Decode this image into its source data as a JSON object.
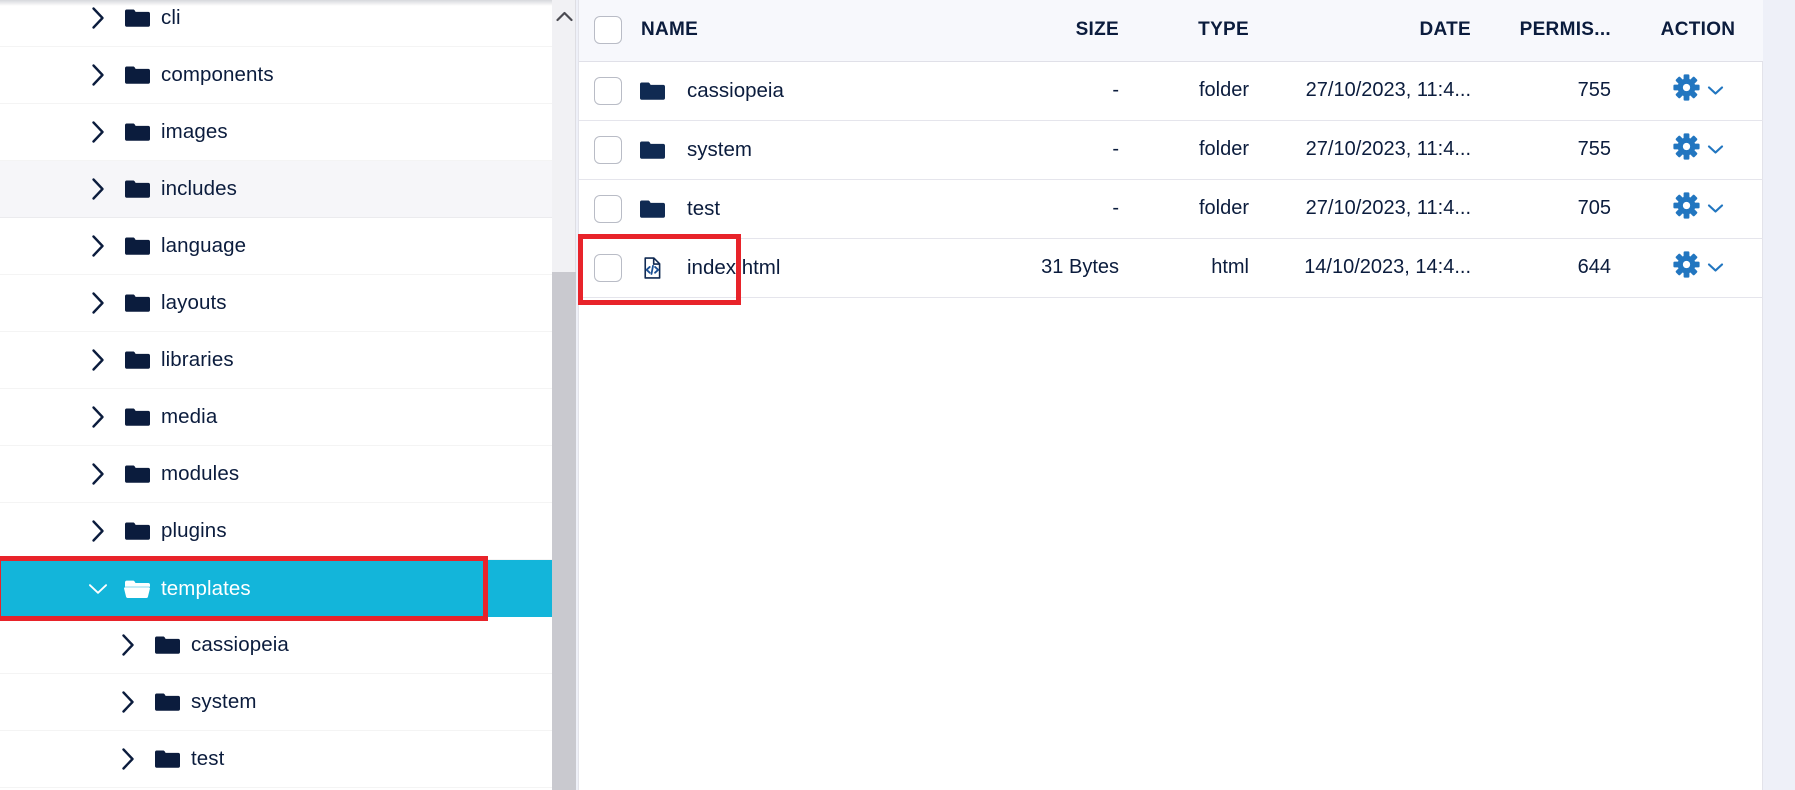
{
  "colors": {
    "selected_bg": "#13b5da",
    "highlight_outline": "#e8232a",
    "text": "#0b1c3d",
    "gear_blue": "#2276c0",
    "header_bg": "#f7f8fc"
  },
  "sidebar": {
    "name": "file-tree",
    "items": [
      {
        "label": "cli",
        "depth": 1,
        "state": "collapsed",
        "selected": false,
        "hovered": false
      },
      {
        "label": "components",
        "depth": 1,
        "state": "collapsed",
        "selected": false,
        "hovered": false
      },
      {
        "label": "images",
        "depth": 1,
        "state": "collapsed",
        "selected": false,
        "hovered": false
      },
      {
        "label": "includes",
        "depth": 1,
        "state": "collapsed",
        "selected": false,
        "hovered": true
      },
      {
        "label": "language",
        "depth": 1,
        "state": "collapsed",
        "selected": false,
        "hovered": false
      },
      {
        "label": "layouts",
        "depth": 1,
        "state": "collapsed",
        "selected": false,
        "hovered": false
      },
      {
        "label": "libraries",
        "depth": 1,
        "state": "collapsed",
        "selected": false,
        "hovered": false
      },
      {
        "label": "media",
        "depth": 1,
        "state": "collapsed",
        "selected": false,
        "hovered": false
      },
      {
        "label": "modules",
        "depth": 1,
        "state": "collapsed",
        "selected": false,
        "hovered": false
      },
      {
        "label": "plugins",
        "depth": 1,
        "state": "collapsed",
        "selected": false,
        "hovered": false
      },
      {
        "label": "templates",
        "depth": 1,
        "state": "expanded",
        "selected": true,
        "hovered": false
      },
      {
        "label": "cassiopeia",
        "depth": 2,
        "state": "collapsed",
        "selected": false,
        "hovered": false
      },
      {
        "label": "system",
        "depth": 2,
        "state": "collapsed",
        "selected": false,
        "hovered": false
      },
      {
        "label": "test",
        "depth": 2,
        "state": "collapsed",
        "selected": false,
        "hovered": false
      }
    ]
  },
  "scrollbar": {
    "name": "vertical-scrollbar",
    "up_arrow": "chevron-up-icon"
  },
  "table": {
    "headers": {
      "select_all": "",
      "name": "NAME",
      "size": "SIZE",
      "type": "TYPE",
      "date": "DATE",
      "permissions": "PERMIS...",
      "action": "ACTION"
    },
    "rows": [
      {
        "name": "cassiopeia",
        "icon": "folder-icon",
        "size": "-",
        "type": "folder",
        "date": "27/10/2023, 11:4...",
        "permissions": "755",
        "action_icon": "gear-icon",
        "action_caret": "chevron-down-icon",
        "checked": false,
        "outlined": false
      },
      {
        "name": "system",
        "icon": "folder-icon",
        "size": "-",
        "type": "folder",
        "date": "27/10/2023, 11:4...",
        "permissions": "755",
        "action_icon": "gear-icon",
        "action_caret": "chevron-down-icon",
        "checked": false,
        "outlined": false
      },
      {
        "name": "test",
        "icon": "folder-icon",
        "size": "-",
        "type": "folder",
        "date": "27/10/2023, 11:4...",
        "permissions": "705",
        "action_icon": "gear-icon",
        "action_caret": "chevron-down-icon",
        "checked": false,
        "outlined": true
      },
      {
        "name": "index.html",
        "icon": "code-file-icon",
        "size": "31 Bytes",
        "type": "html",
        "date": "14/10/2023, 14:4...",
        "permissions": "644",
        "action_icon": "gear-icon",
        "action_caret": "chevron-down-icon",
        "checked": false,
        "outlined": false
      }
    ]
  }
}
